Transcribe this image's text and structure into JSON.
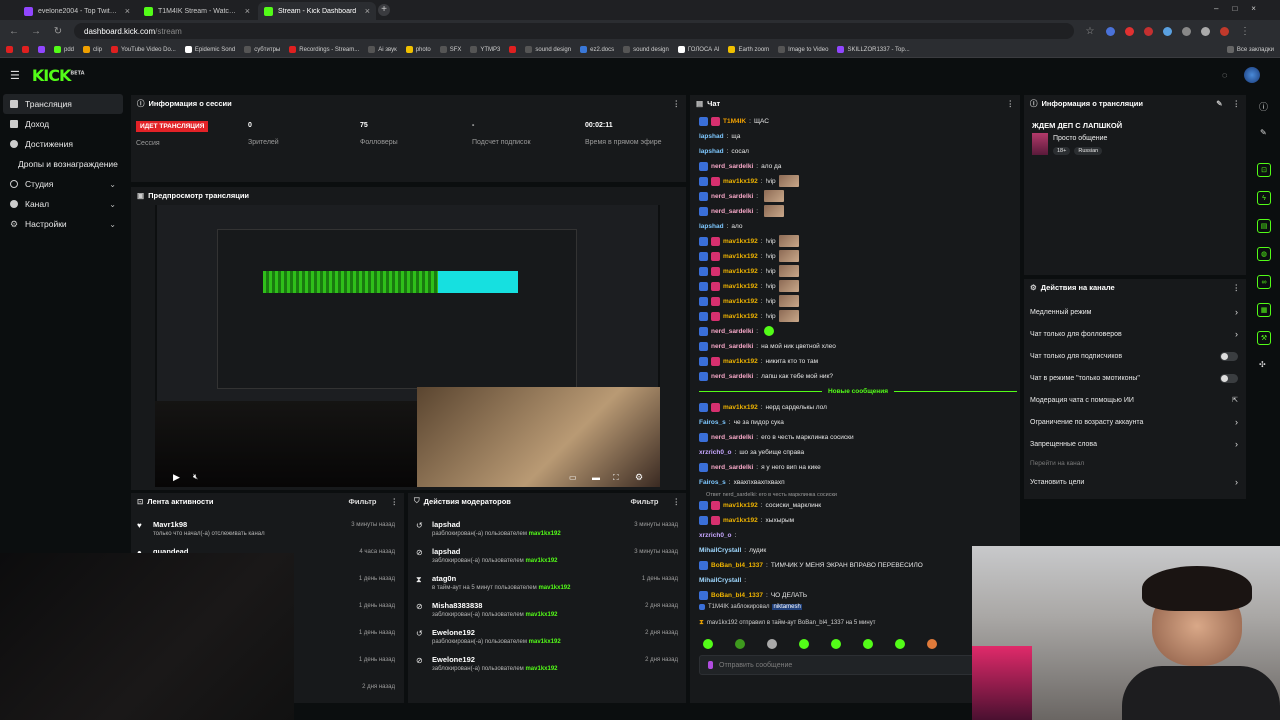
{
  "browser": {
    "tabs": [
      {
        "label": "evelone2004 - Top Twitch Clips",
        "active": false
      },
      {
        "label": "T1M4IK Stream - Watch Live o...",
        "active": false
      },
      {
        "label": "Stream - Kick Dashboard",
        "active": true
      }
    ],
    "url_host": "dashboard.kick.com",
    "url_path": "/stream",
    "bookmarks": [
      "pdd",
      "clip",
      "YouTube Video Do...",
      "Epidemic Sond",
      "субтитры",
      "Recordings - Stream...",
      "Ai звук",
      "photo",
      "SFX",
      "YTMP3",
      "sound design",
      "ez2.docs",
      "sound design",
      "ГОЛОСА AI",
      "Earth zoom",
      "Image to Video",
      "SKILLZOR1337 - Top..."
    ],
    "all_bookmarks": "Все закладки"
  },
  "app": {
    "logo": "KICK",
    "logo_sup": "BETA",
    "sidebar": [
      {
        "label": "Трансляция",
        "active": true,
        "chevron": false
      },
      {
        "label": "Доход",
        "active": false,
        "chevron": false
      },
      {
        "label": "Достижения",
        "active": false,
        "chevron": false
      },
      {
        "label": "Дропы и вознаграждение",
        "active": false,
        "chevron": false
      },
      {
        "label": "Студия",
        "active": false,
        "chevron": true
      },
      {
        "label": "Канал",
        "active": false,
        "chevron": true
      },
      {
        "label": "Настройки",
        "active": false,
        "chevron": true
      }
    ]
  },
  "session": {
    "title": "Информация о сессии",
    "live_badge": "ИДЕТ ТРАНСЛЯЦИЯ",
    "session_label": "Сессия",
    "stats": [
      {
        "value": "0",
        "label": "Зрителей"
      },
      {
        "value": "75",
        "label": "Фолловеры"
      },
      {
        "value": "-",
        "label": "Подсчет подписок"
      },
      {
        "value": "00:02:11",
        "label": "Время в прямом эфире"
      }
    ]
  },
  "preview": {
    "title": "Предпросмотр трансляции"
  },
  "activity": {
    "title": "Лента активности",
    "filter": "Фильтр",
    "rows": [
      {
        "name": "Mavr1k98",
        "desc": "только что начал(-а) отслеживать канал",
        "time": "3 минуты назад"
      },
      {
        "name": "quandead",
        "desc": "",
        "time": "4 часа назад"
      },
      {
        "name": "",
        "desc": "",
        "time": "1 день назад"
      },
      {
        "name": "",
        "desc": "",
        "time": "1 день назад"
      },
      {
        "name": "",
        "desc": "",
        "time": "1 день назад"
      },
      {
        "name": "",
        "desc": "",
        "time": "1 день назад"
      },
      {
        "name": "",
        "desc": "",
        "time": "2 дня назад"
      }
    ]
  },
  "mod_actions": {
    "title": "Действия модераторов",
    "filter": "Фильтр",
    "rows": [
      {
        "name": "lapshad",
        "desc": "разблокирован(-а) пользователем",
        "by": "mav1kx192",
        "time": "3 минуты назад",
        "icon": "undo"
      },
      {
        "name": "lapshad",
        "desc": "заблокирован(-а) пользователем",
        "by": "mav1kx192",
        "time": "3 минуты назад",
        "icon": "ban"
      },
      {
        "name": "atag0n",
        "desc": "в тайм-аут на 5 минут пользователем",
        "by": "mav1kx192",
        "time": "1 день назад",
        "icon": "timeout"
      },
      {
        "name": "Misha8383838",
        "desc": "заблокирован(-а) пользователем",
        "by": "mav1kx192",
        "time": "2 дня назад",
        "icon": "ban"
      },
      {
        "name": "Ewelone192",
        "desc": "разблокирован(-а) пользователем",
        "by": "mav1kx192",
        "time": "2 дня назад",
        "icon": "undo"
      },
      {
        "name": "Ewelone192",
        "desc": "заблокирован(-а) пользователем",
        "by": "mav1kx192",
        "time": "2 дня назад",
        "icon": "ban"
      }
    ]
  },
  "chat": {
    "title": "Чат",
    "messages": [
      {
        "user": "T1M4IK",
        "color": "#f0a000",
        "text": "ЩАС",
        "badges": 2
      },
      {
        "user": "lapshad",
        "color": "#7ec8ff",
        "text": "ща",
        "badges": 0
      },
      {
        "user": "lapshad",
        "color": "#7ec8ff",
        "text": "сосал",
        "badges": 0
      },
      {
        "user": "nerd_sardelki",
        "color": "#f7a8c8",
        "text": "ало да",
        "badges": 1
      },
      {
        "user": "mav1kx192",
        "color": "#f0b400",
        "text": "!vip",
        "badges": 2,
        "emote": true
      },
      {
        "user": "nerd_sardelki",
        "color": "#f7a8c8",
        "text": "",
        "badges": 1,
        "emote": true
      },
      {
        "user": "nerd_sardelki",
        "color": "#f7a8c8",
        "text": "",
        "badges": 1,
        "emote": true
      },
      {
        "user": "lapshad",
        "color": "#7ec8ff",
        "text": "ало",
        "badges": 0
      },
      {
        "user": "mav1kx192",
        "color": "#f0b400",
        "text": "!vip",
        "badges": 2,
        "emote": true
      },
      {
        "user": "mav1kx192",
        "color": "#f0b400",
        "text": "!vip",
        "badges": 2,
        "emote": true
      },
      {
        "user": "mav1kx192",
        "color": "#f0b400",
        "text": "!vip",
        "badges": 2,
        "emote": true
      },
      {
        "user": "mav1kx192",
        "color": "#f0b400",
        "text": "!vip",
        "badges": 2,
        "emote": true
      },
      {
        "user": "mav1kx192",
        "color": "#f0b400",
        "text": "!vip",
        "badges": 2,
        "emote": true
      },
      {
        "user": "mav1kx192",
        "color": "#f0b400",
        "text": "!vip",
        "badges": 2,
        "emote": true
      },
      {
        "user": "nerd_sardelki",
        "color": "#f7a8c8",
        "text": "",
        "badges": 1,
        "green": true
      },
      {
        "user": "nerd_sardelki",
        "color": "#f7a8c8",
        "text": "на мой ник цветной хлео",
        "badges": 1
      },
      {
        "user": "mav1kx192",
        "color": "#f0b400",
        "text": "никита кто то там",
        "badges": 2
      },
      {
        "user": "nerd_sardelki",
        "color": "#f7a8c8",
        "text": "лапш как тебе мой ник?",
        "badges": 1
      }
    ],
    "new_messages": "Новые сообщения",
    "messages2": [
      {
        "user": "mav1kx192",
        "color": "#f0b400",
        "text": "нерд сарделькы лол",
        "badges": 2
      },
      {
        "user": "Fairos_s",
        "color": "#7ec8ff",
        "text": "че за пидор сука",
        "badges": 0
      },
      {
        "user": "nerd_sardelki",
        "color": "#f7a8c8",
        "text": "его в честь марклинка сосиски",
        "badges": 1
      },
      {
        "user": "xrzrich0_o",
        "color": "#c7a7ff",
        "text": "шо за уебище справа",
        "badges": 0
      },
      {
        "user": "nerd_sardelki",
        "color": "#f7a8c8",
        "text": "я у него вип на кике",
        "badges": 1
      },
      {
        "user": "Fairos_s",
        "color": "#7ec8ff",
        "text": "хвахпхвахпхвахп",
        "badges": 0
      }
    ],
    "reply_hint": "Ответ nerd_sardelki: его в честь марклинка сосиски",
    "messages3": [
      {
        "user": "mav1kx192",
        "color": "#f0b400",
        "text": "сосиски_марклинк",
        "badges": 2
      },
      {
        "user": "mav1kx192",
        "color": "#f0b400",
        "text": "хыхырым",
        "badges": 2
      },
      {
        "user": "xrzrich0_o",
        "color": "#c7a7ff",
        "text": "",
        "badges": 0
      },
      {
        "user": "MihailCrystall",
        "color": "#9fd8ff",
        "text": "лудик",
        "badges": 0
      },
      {
        "user": "BoBan_bl4_1337",
        "color": "#f0b400",
        "text": "ТИМЧИК У МЕНЯ ЭКРАН ВПРАВО ПЕРЕВЕСИЛО",
        "badges": 1
      },
      {
        "user": "MihailCrystall",
        "color": "#9fd8ff",
        "text": "",
        "badges": 0
      },
      {
        "user": "BoBan_bl4_1337",
        "color": "#f0b400",
        "text": "ЧО ДЕЛАТЬ",
        "badges": 1
      }
    ],
    "sys1_a": "T1M4IK заблокировал",
    "sys1_b": "niktamesh",
    "sys2": "mav1kx192 отправил в тайм-аут BoBan_bl4_1337 на 5 минут",
    "input_placeholder": "Отправить сообщение"
  },
  "stream_info": {
    "title": "Информация о трансляции",
    "stream_title": "ЖДЕМ ДЕП С ЛАПШКОЙ",
    "category": "Просто общение",
    "tags": [
      "18+",
      "Russian"
    ]
  },
  "channel_actions": {
    "title": "Действия на канале",
    "items": [
      {
        "label": "Медленный режим",
        "control": "arrow"
      },
      {
        "label": "Чат только для фолловеров",
        "control": "arrow"
      },
      {
        "label": "Чат только для подписчиков",
        "control": "toggle"
      },
      {
        "label": "Чат в режиме \"только эмотиконы\"",
        "control": "toggle"
      },
      {
        "label": "Модерация чата с помощью ИИ",
        "control": "external"
      },
      {
        "label": "Ограничение по возрасту аккаунта",
        "control": "arrow"
      },
      {
        "label": "Запрещенные слова",
        "control": "arrow"
      },
      {
        "label": "Перейти на канал",
        "control": "none"
      },
      {
        "label": "Установить цели",
        "control": "arrow"
      }
    ]
  }
}
